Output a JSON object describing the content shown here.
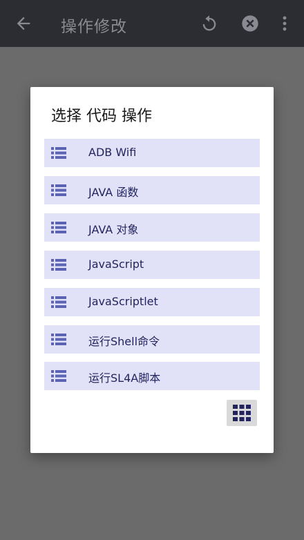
{
  "appbar": {
    "title": "操作修改",
    "icons": [
      "back-arrow-icon",
      "undo-icon",
      "close-circle-icon",
      "more-vert-icon"
    ],
    "background": "#2c2d33"
  },
  "dialog": {
    "title": "选择 代码 操作",
    "items": [
      {
        "label": "ADB Wifi",
        "icon": "list-icon"
      },
      {
        "label": "JAVA 函数",
        "icon": "list-icon"
      },
      {
        "label": "JAVA 对象",
        "icon": "list-icon"
      },
      {
        "label": "JavaScript",
        "icon": "list-icon"
      },
      {
        "label": "JavaScriptlet",
        "icon": "list-icon"
      },
      {
        "label": "运行Shell命令",
        "icon": "list-icon"
      },
      {
        "label": "运行SL4A脚本",
        "icon": "list-icon"
      }
    ],
    "grid_button_icon": "grid-icon",
    "item_background": "#e1e2f7",
    "item_text_color": "#23245e",
    "icon_color": "#5c63b3"
  }
}
